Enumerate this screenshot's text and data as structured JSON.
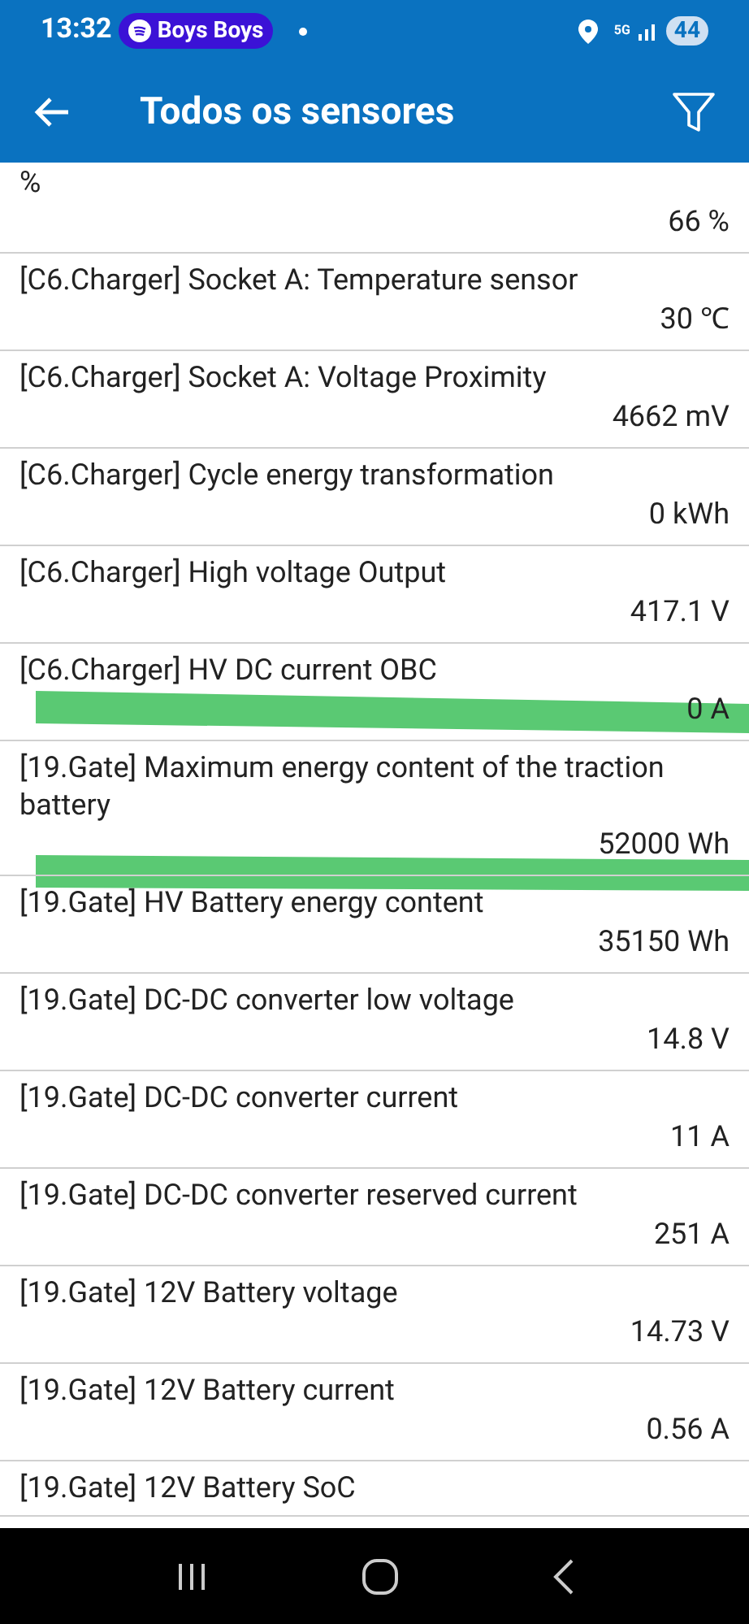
{
  "status_bar": {
    "time": "13:32",
    "media": "Boys Boys",
    "network": "5G",
    "battery": "44"
  },
  "app_bar": {
    "title": "Todos os sensores"
  },
  "sensors": [
    {
      "name": "%",
      "value": "66 %"
    },
    {
      "name": "[C6.Charger] Socket A: Temperature sensor",
      "value": "30 ℃"
    },
    {
      "name": "[C6.Charger] Socket A: Voltage Proximity",
      "value": "4662 mV"
    },
    {
      "name": "[C6.Charger] Cycle energy transformation",
      "value": "0 kWh"
    },
    {
      "name": "[C6.Charger] High voltage Output",
      "value": "417.1 V"
    },
    {
      "name": "[C6.Charger] HV DC current OBC",
      "value": "0 A"
    },
    {
      "name": "[19.Gate] Maximum energy content of the traction battery",
      "value": "52000 Wh"
    },
    {
      "name": "[19.Gate] HV Battery energy content",
      "value": "35150 Wh"
    },
    {
      "name": "[19.Gate] DC-DC converter low voltage",
      "value": "14.8 V"
    },
    {
      "name": "[19.Gate] DC-DC converter current",
      "value": "11 A"
    },
    {
      "name": "[19.Gate] DC-DC converter reserved current",
      "value": "251 A"
    },
    {
      "name": "[19.Gate] 12V Battery voltage",
      "value": "14.73 V"
    },
    {
      "name": "[19.Gate] 12V Battery current",
      "value": "0.56 A"
    },
    {
      "name": "[19.Gate] 12V Battery SoC"
    }
  ]
}
